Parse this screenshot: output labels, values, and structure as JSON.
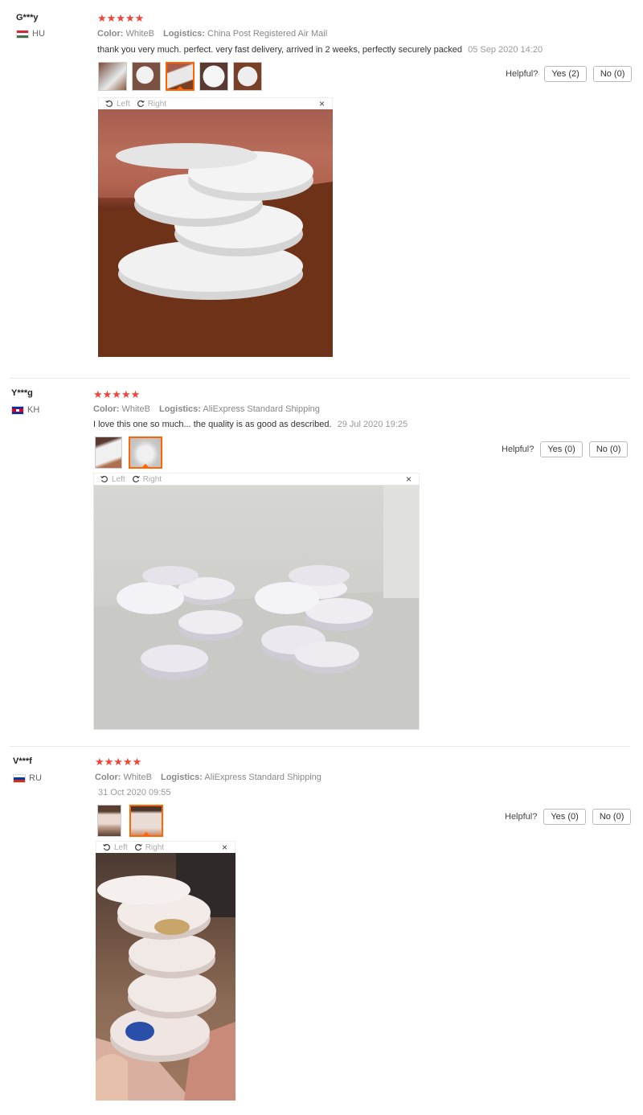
{
  "reviews": [
    {
      "user": "G***y",
      "country": "HU",
      "stars": "★★★★★",
      "color_label": "Color:",
      "color_value": "WhiteB",
      "logistics_label": "Logistics:",
      "logistics_value": "China Post Registered Air Mail",
      "text": "thank you very much. perfect. very fast delivery, arrived in 2 weeks, perfectly securely packed",
      "date": "05 Sep 2020 14:20",
      "helpful_label": "Helpful?",
      "yes": "Yes (2)",
      "no": "No (0)",
      "viewer": {
        "left": "Left",
        "right": "Right",
        "close": "×"
      }
    },
    {
      "user": "Y***g",
      "country": "KH",
      "stars": "★★★★★",
      "color_label": "Color:",
      "color_value": "WhiteB",
      "logistics_label": "Logistics:",
      "logistics_value": "AliExpress Standard Shipping",
      "text": "I love this one so much... the quality is as good as described.",
      "date": "29 Jul 2020 19:25",
      "helpful_label": "Helpful?",
      "yes": "Yes (0)",
      "no": "No (0)",
      "viewer": {
        "left": "Left",
        "right": "Right",
        "close": "×"
      }
    },
    {
      "user": "V***f",
      "country": "RU",
      "stars": "★★★★★",
      "color_label": "Color:",
      "color_value": "WhiteB",
      "logistics_label": "Logistics:",
      "logistics_value": "AliExpress Standard Shipping",
      "text": "",
      "date": "31 Oct 2020 09:55",
      "helpful_label": "Helpful?",
      "yes": "Yes (0)",
      "no": "No (0)",
      "viewer": {
        "left": "Left",
        "right": "Right",
        "close": "×"
      }
    }
  ],
  "colors": {
    "star": "#f44336",
    "active_thumb": "#ff6600",
    "meta_text": "#888888"
  }
}
